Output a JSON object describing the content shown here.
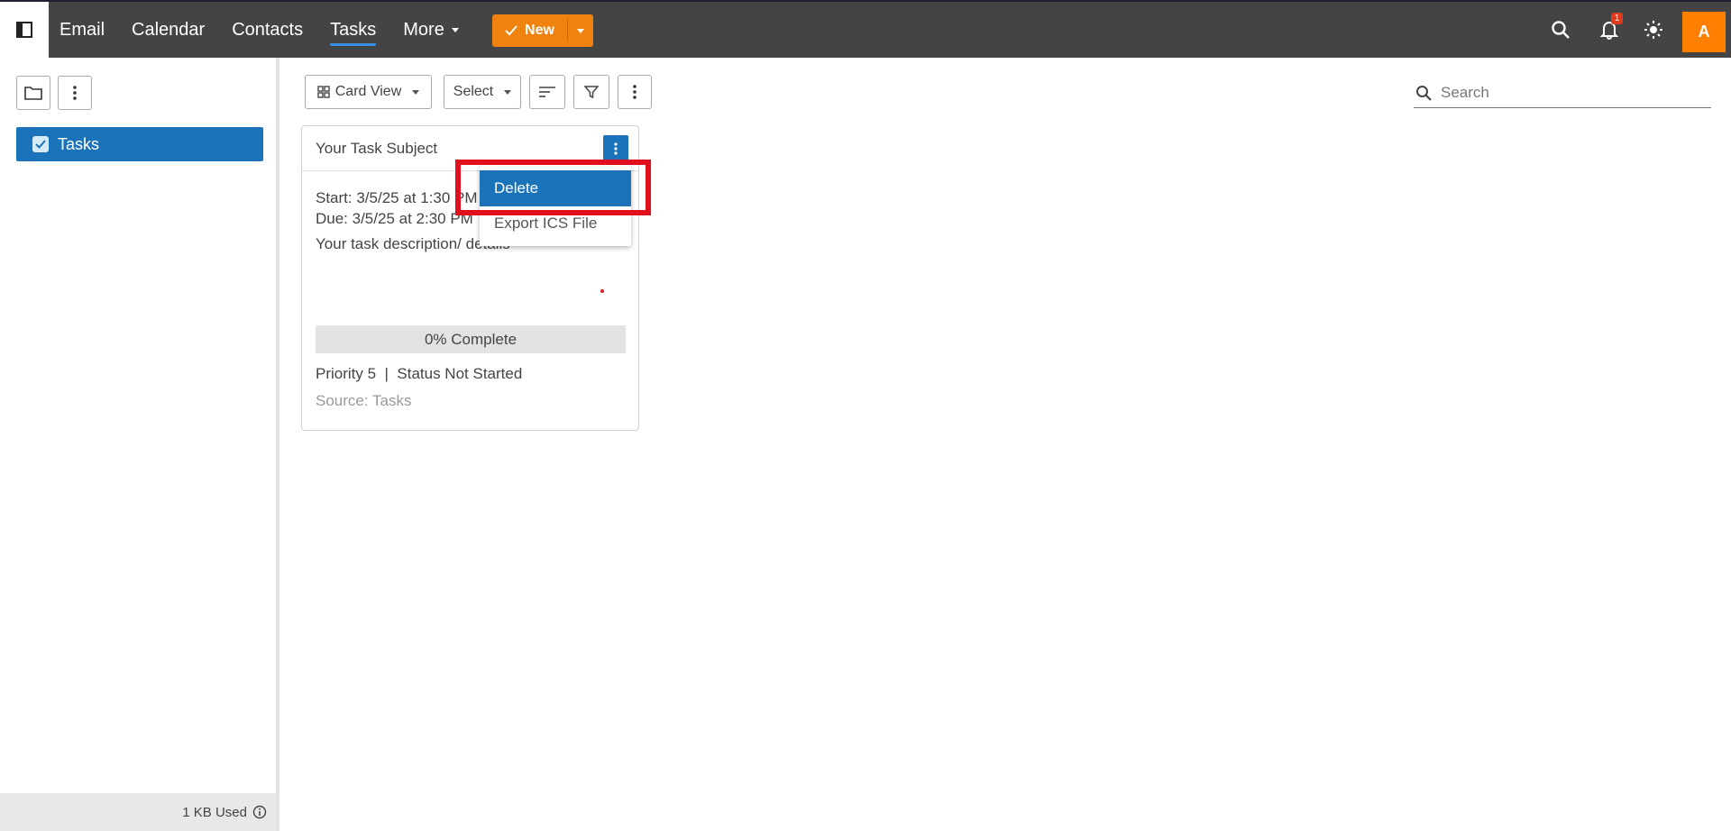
{
  "topbar": {
    "nav": [
      {
        "label": "Email"
      },
      {
        "label": "Calendar"
      },
      {
        "label": "Contacts"
      },
      {
        "label": "Tasks",
        "active": true
      },
      {
        "label": "More"
      }
    ],
    "new_button": {
      "label": "New",
      "color": "#f0820f"
    },
    "notifications_count": "1",
    "avatar_initial": "A",
    "avatar_color": "#ff8000"
  },
  "left_panel": {
    "folder_item": {
      "label": "Tasks",
      "checked": true
    },
    "storage_label": "1 KB Used"
  },
  "toolbar": {
    "view_label": "Card View",
    "select_label": "Select",
    "search_placeholder": "Search"
  },
  "task_card": {
    "subject": "Your Task Subject",
    "start": "Start: 3/5/25 at 1:30 PM",
    "due": "Due: 3/5/25 at 2:30 PM",
    "description": "Your task description/ details",
    "progress_label": "0% Complete",
    "progress_fraction": 0,
    "meta": "Priority 5  |  Status Not Started",
    "source": "Source: Tasks"
  },
  "context_menu": {
    "items": [
      {
        "label": "Delete",
        "selected": true
      },
      {
        "label": "Export ICS File",
        "selected": false
      }
    ]
  },
  "colors": {
    "accent_blue": "#1b74b9",
    "topbar_bg": "#444444",
    "highlight_red": "#e0101e"
  }
}
